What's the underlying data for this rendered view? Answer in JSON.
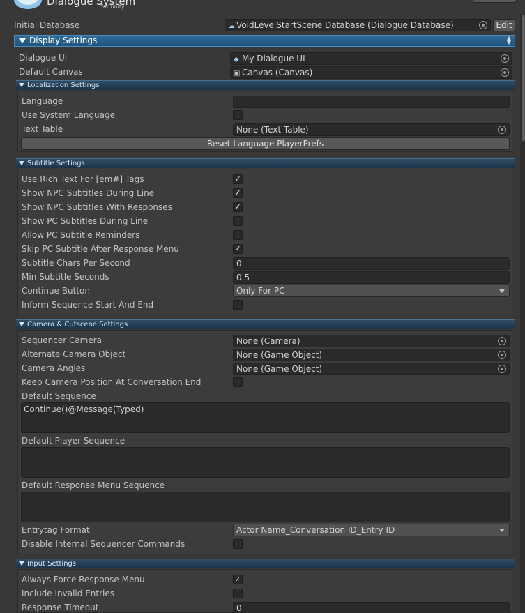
{
  "header": {
    "logo_title": "Dialogue System",
    "logo_subtitle": "for unity"
  },
  "initial_database": {
    "label": "Initial Database",
    "value": "VoidLevelStartScene Database (Dialogue Database)",
    "edit_label": "Edit"
  },
  "display_settings": {
    "title": "Display Settings",
    "dialogue_ui": {
      "label": "Dialogue UI",
      "value": "My Dialogue UI"
    },
    "default_canvas": {
      "label": "Default Canvas",
      "value": "Canvas (Canvas)"
    }
  },
  "localization": {
    "title": "Localization Settings",
    "language": {
      "label": "Language",
      "value": ""
    },
    "use_system_language": {
      "label": "Use System Language",
      "checked": false
    },
    "text_table": {
      "label": "Text Table",
      "value": "None (Text Table)"
    },
    "reset_button": "Reset Language PlayerPrefs"
  },
  "subtitle": {
    "title": "Subtitle Settings",
    "rows": [
      {
        "label": "Use Rich Text For [em#] Tags",
        "mark": "✓"
      },
      {
        "label": "Show NPC Subtitles During Line",
        "mark": "✓"
      },
      {
        "label": "Show NPC Subtitles With Responses",
        "mark": "✓"
      },
      {
        "label": "Show PC Subtitles During Line",
        "mark": ""
      },
      {
        "label": "Allow PC Subtitle Reminders",
        "mark": ""
      },
      {
        "label": "Skip PC Subtitle After Response Menu",
        "mark": "✓"
      }
    ],
    "chars_per_second": {
      "label": "Subtitle Chars Per Second",
      "value": "0"
    },
    "min_seconds": {
      "label": "Min Subtitle Seconds",
      "value": "0.5"
    },
    "continue_button": {
      "label": "Continue Button",
      "value": "Only For PC"
    },
    "inform_sequence": {
      "label": "Inform Sequence Start And End",
      "mark": ""
    }
  },
  "camera": {
    "title": "Camera & Cutscene Settings",
    "sequencer_camera": {
      "label": "Sequencer Camera",
      "value": "None (Camera)"
    },
    "alternate_camera": {
      "label": "Alternate Camera Object",
      "value": "None (Game Object)"
    },
    "camera_angles": {
      "label": "Camera Angles",
      "value": "None (Game Object)"
    },
    "keep_position": {
      "label": "Keep Camera Position At Conversation End",
      "mark": ""
    },
    "default_sequence": {
      "label": "Default Sequence",
      "value": "Continue()@Message(Typed)"
    },
    "default_player_sequence": {
      "label": "Default Player Sequence",
      "value": ""
    },
    "default_response_menu_sequence": {
      "label": "Default Response Menu Sequence",
      "value": ""
    },
    "entrytag_format": {
      "label": "Entrytag Format",
      "value": "Actor Name_Conversation ID_Entry ID"
    },
    "disable_internal": {
      "label": "Disable Internal Sequencer Commands",
      "mark": ""
    }
  },
  "input": {
    "title": "Input Settings",
    "always_force": {
      "label": "Always Force Response Menu",
      "mark": "✓"
    },
    "include_invalid": {
      "label": "Include Invalid Entries",
      "mark": ""
    },
    "response_timeout": {
      "label": "Response Timeout",
      "value": "0"
    }
  },
  "colors": {
    "background": "#383838",
    "section_header": "#1c3348",
    "display_header": "#2f6c99"
  }
}
